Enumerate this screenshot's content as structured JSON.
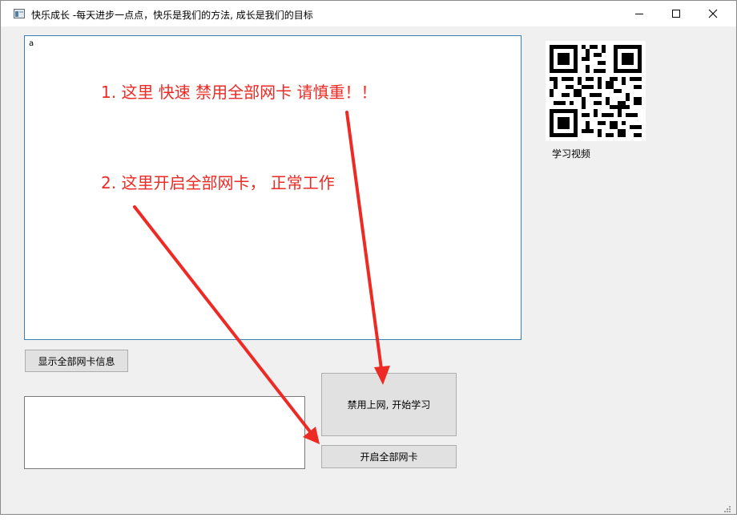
{
  "window": {
    "title": "快乐成长 -每天进步一点点，快乐是我们的方法, 成长是我们的目标"
  },
  "log": {
    "text": "a"
  },
  "qr": {
    "caption": "学习视频"
  },
  "buttons": {
    "show_all": "显示全部网卡信息",
    "disable_all": "禁用上网, 开始学习",
    "enable_all": "开启全部网卡"
  },
  "output": {
    "value": ""
  },
  "annotations": {
    "step1": "1. 这里 快速 禁用全部网卡    请慎重！！",
    "step2": "2. 这里开启全部网卡，  正常工作"
  },
  "colors": {
    "annotation": "#ee2a24",
    "focus_border": "#3c7fb1"
  },
  "icons": [
    "app-icon",
    "minimize-icon",
    "maximize-icon",
    "close-icon",
    "resize-grip-icon"
  ]
}
